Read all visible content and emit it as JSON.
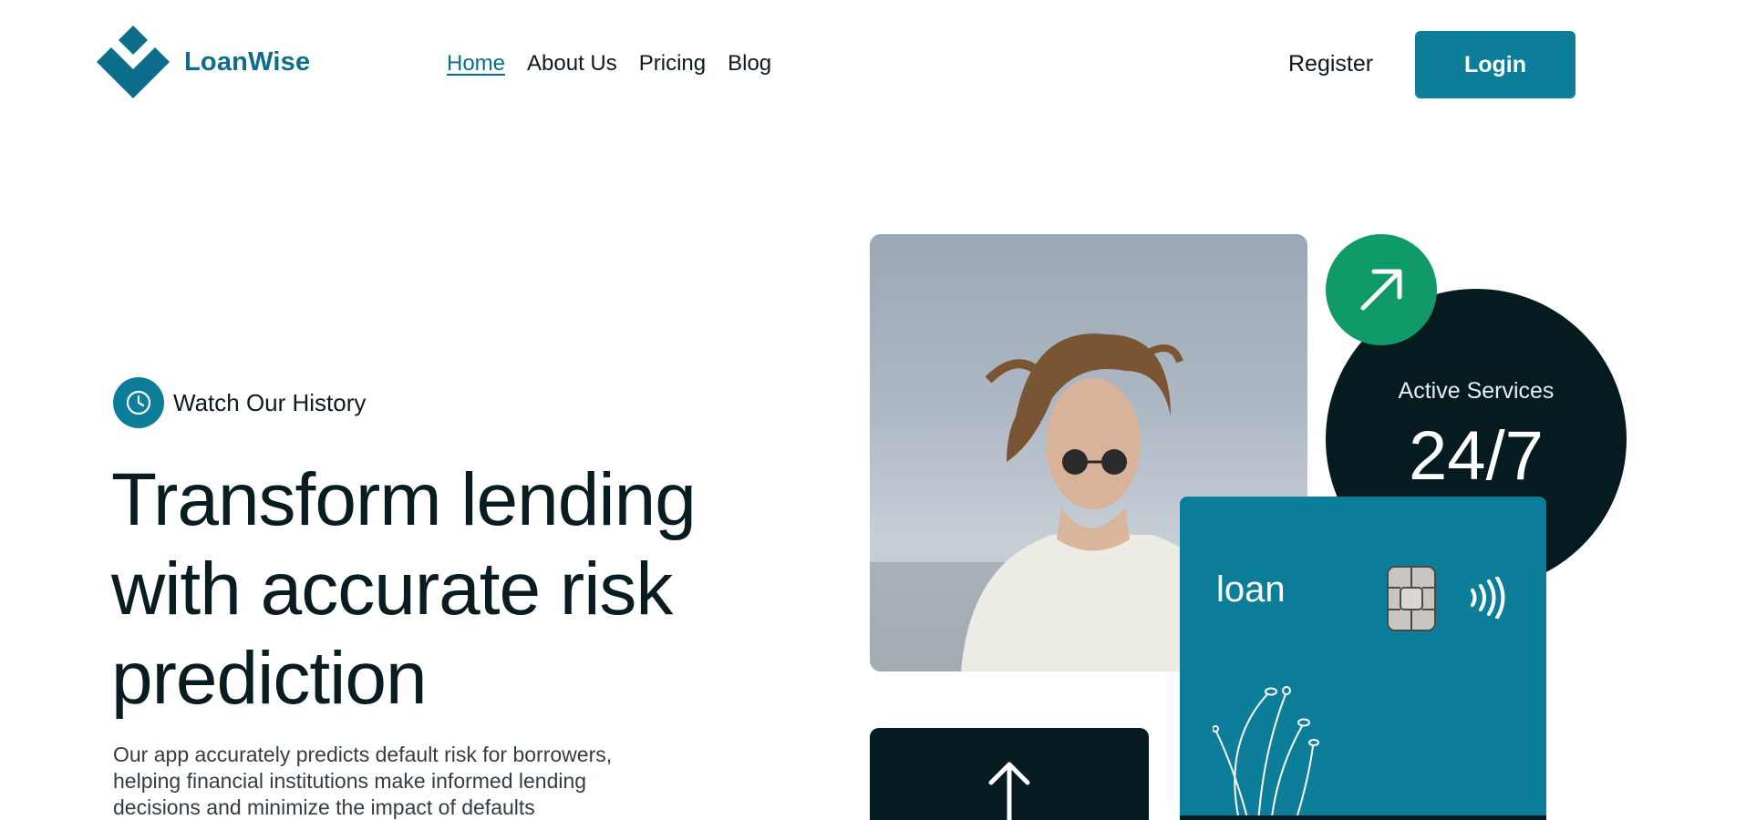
{
  "header": {
    "brand": "LoanWise",
    "nav": [
      {
        "label": "Home",
        "active": true
      },
      {
        "label": "About Us",
        "active": false
      },
      {
        "label": "Pricing",
        "active": false
      },
      {
        "label": "Blog",
        "active": false
      }
    ],
    "register_label": "Register",
    "login_label": "Login"
  },
  "hero": {
    "history_label": "Watch Our History",
    "headline": "Transform lending with accurate risk prediction",
    "description": "Our app accurately predicts default risk for borrowers, helping financial institutions make informed lending decisions and minimize the impact of defaults"
  },
  "stats": {
    "label": "Active Services",
    "value": "24/7"
  },
  "card": {
    "label": "loan"
  },
  "icons": {
    "history": "clock-icon",
    "stats": "arrow-up-right-icon",
    "card_chip": "chip-icon",
    "card_contactless": "contactless-icon",
    "dark_box": "arrow-up-icon"
  },
  "colors": {
    "brand": "#0d6e8c",
    "accent": "#0d7e99",
    "dark": "#051b20",
    "green": "#0f9a68"
  }
}
